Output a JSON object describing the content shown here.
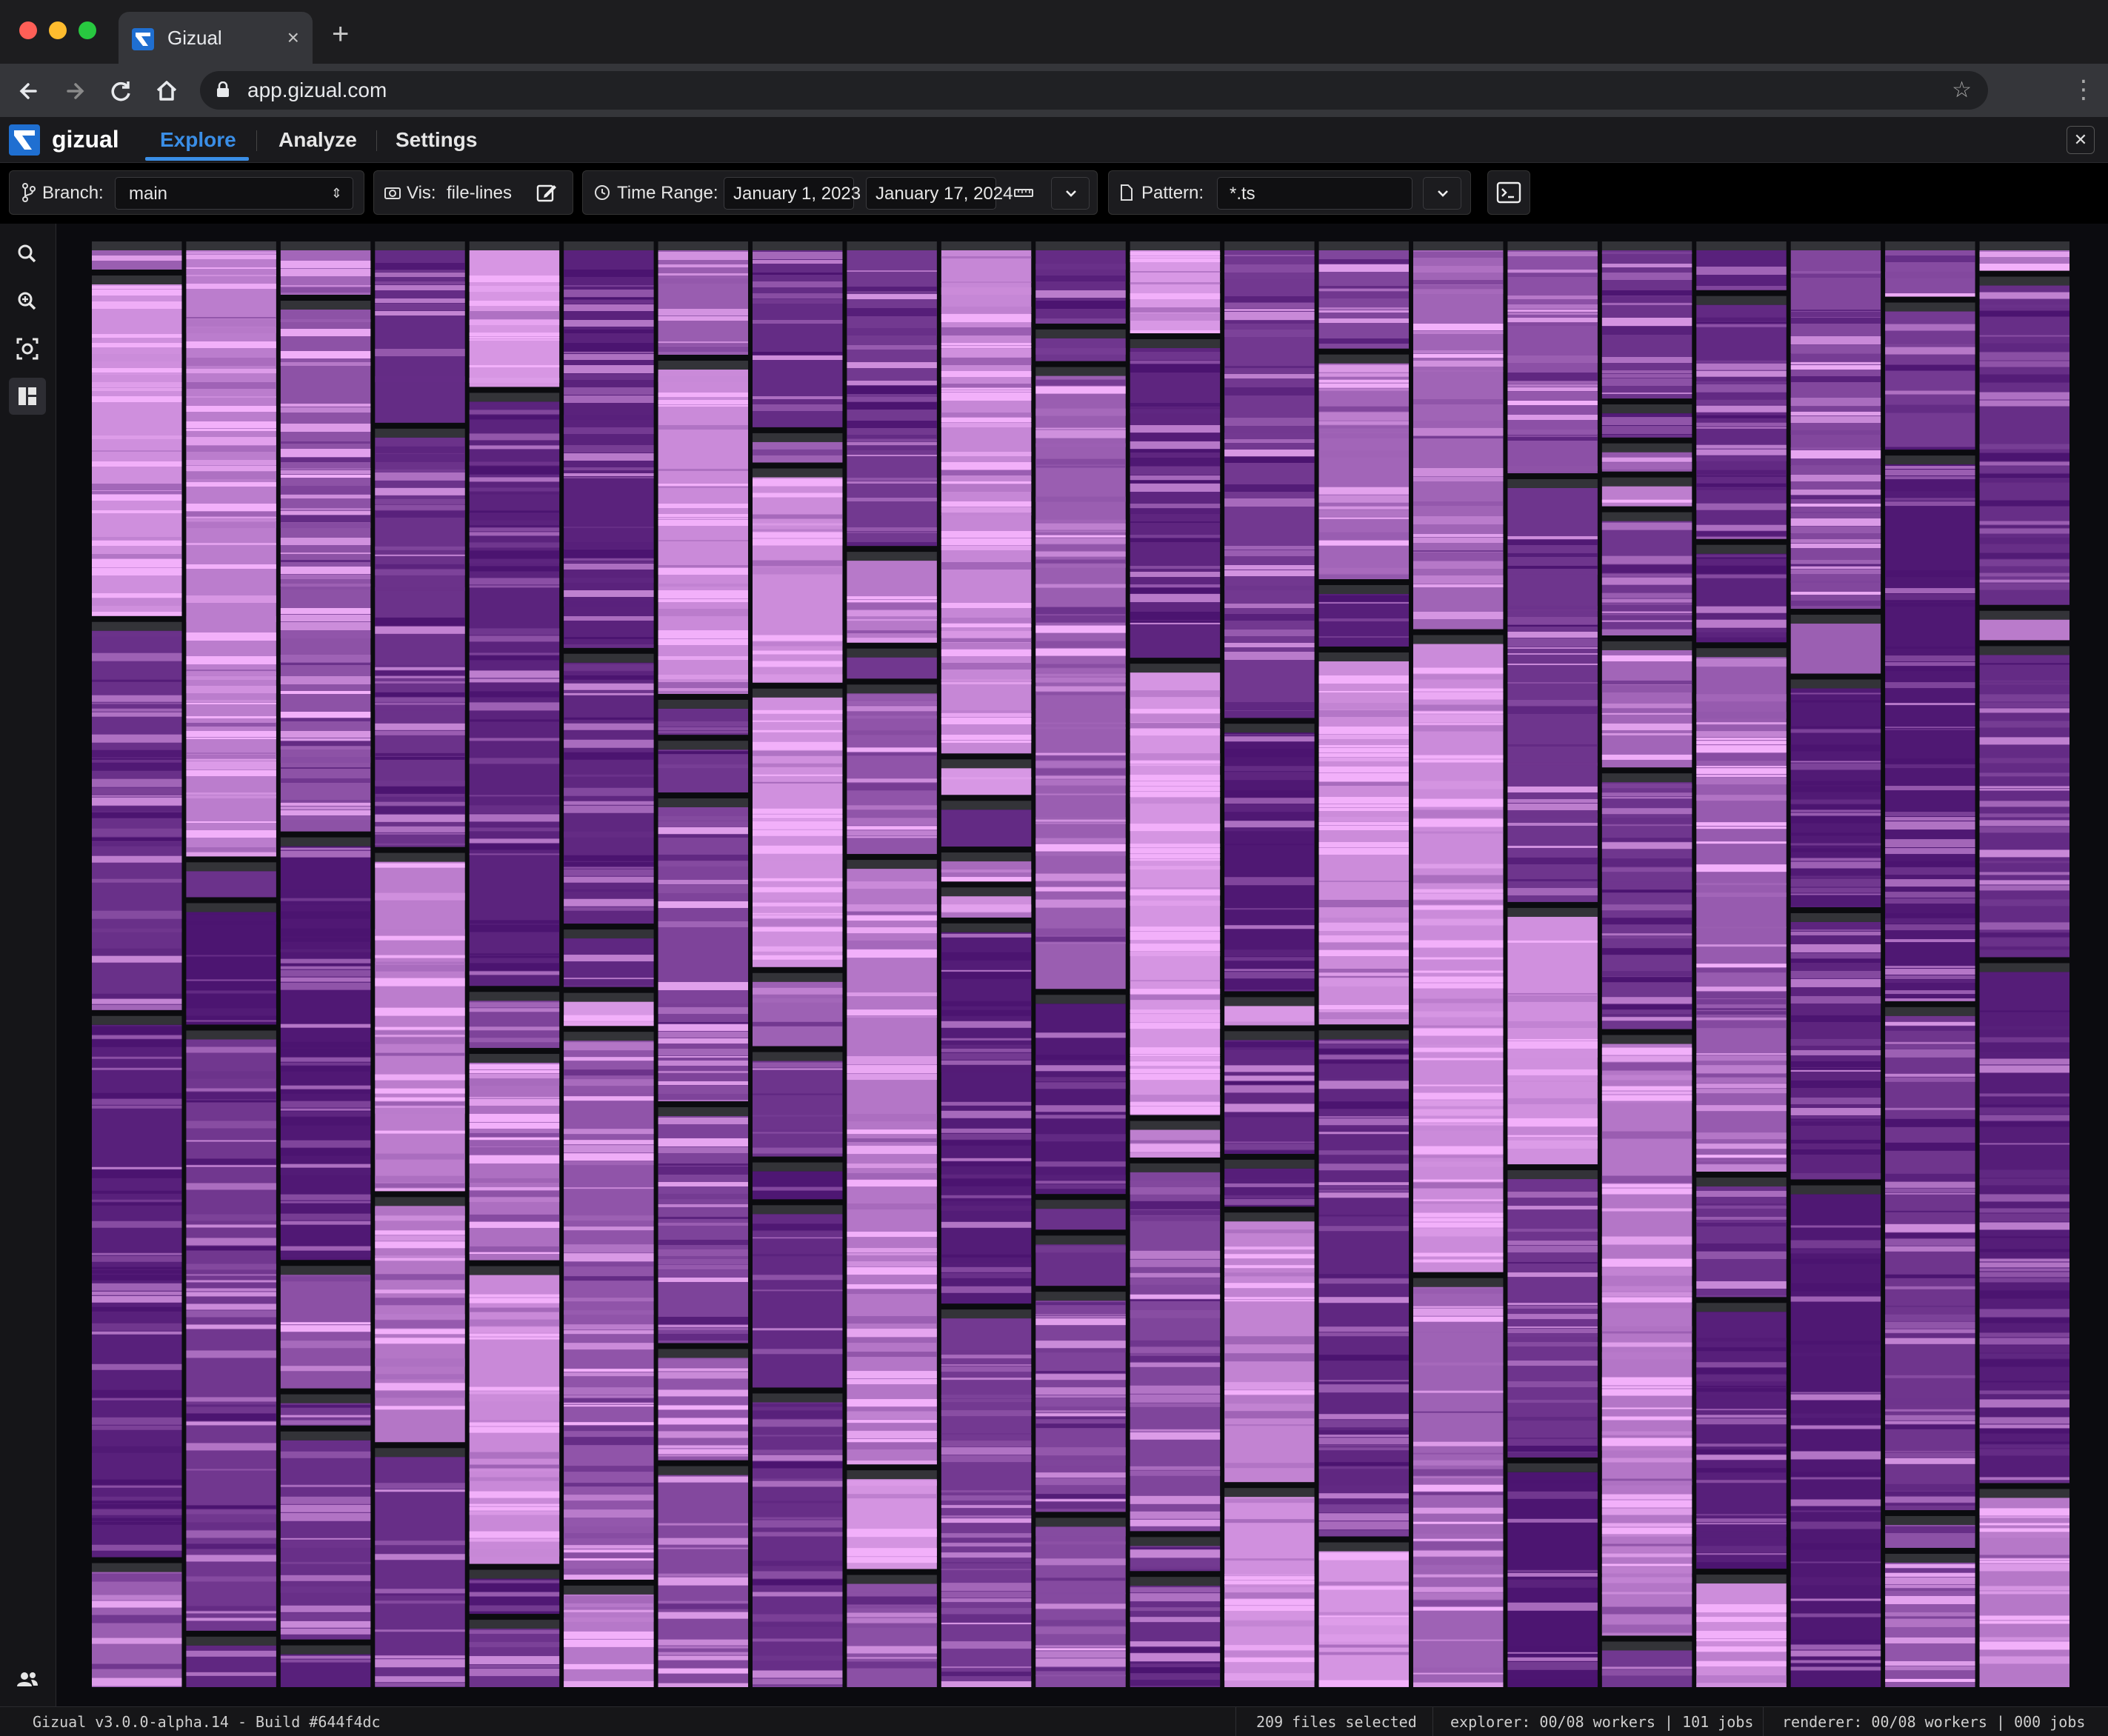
{
  "browser": {
    "tab_title": "Gizual",
    "tab_close": "×",
    "new_tab": "+",
    "url": "app.gizual.com"
  },
  "app": {
    "logo_text": "gizual",
    "nav": [
      "Explore",
      "Analyze",
      "Settings"
    ],
    "active_tab": "Explore",
    "close": "✕"
  },
  "toolbar": {
    "branch_label": "Branch:",
    "branch_value": "main",
    "vis_label": "Vis:",
    "vis_value": "file-lines",
    "time_label": "Time Range:",
    "time_start": "January 1, 2023",
    "time_end": "January 17, 2024",
    "pattern_label": "Pattern:",
    "pattern_value": "*.ts"
  },
  "sidebar": [
    "search-icon",
    "zoom-icon",
    "screenshot-icon",
    "layout-icon",
    "users-icon"
  ],
  "visualization": {
    "file_count": 209,
    "color_newest": "#f2b0fa",
    "color_oldest": "#4b1470",
    "color_header": "#333338"
  },
  "status": {
    "version": "Gizual v3.0.0-alpha.14 - Build #644f4dc",
    "files": "209 files selected",
    "explorer": "explorer: 00/08 workers | 101 jobs",
    "renderer": "renderer: 00/08 workers | 000 jobs"
  }
}
